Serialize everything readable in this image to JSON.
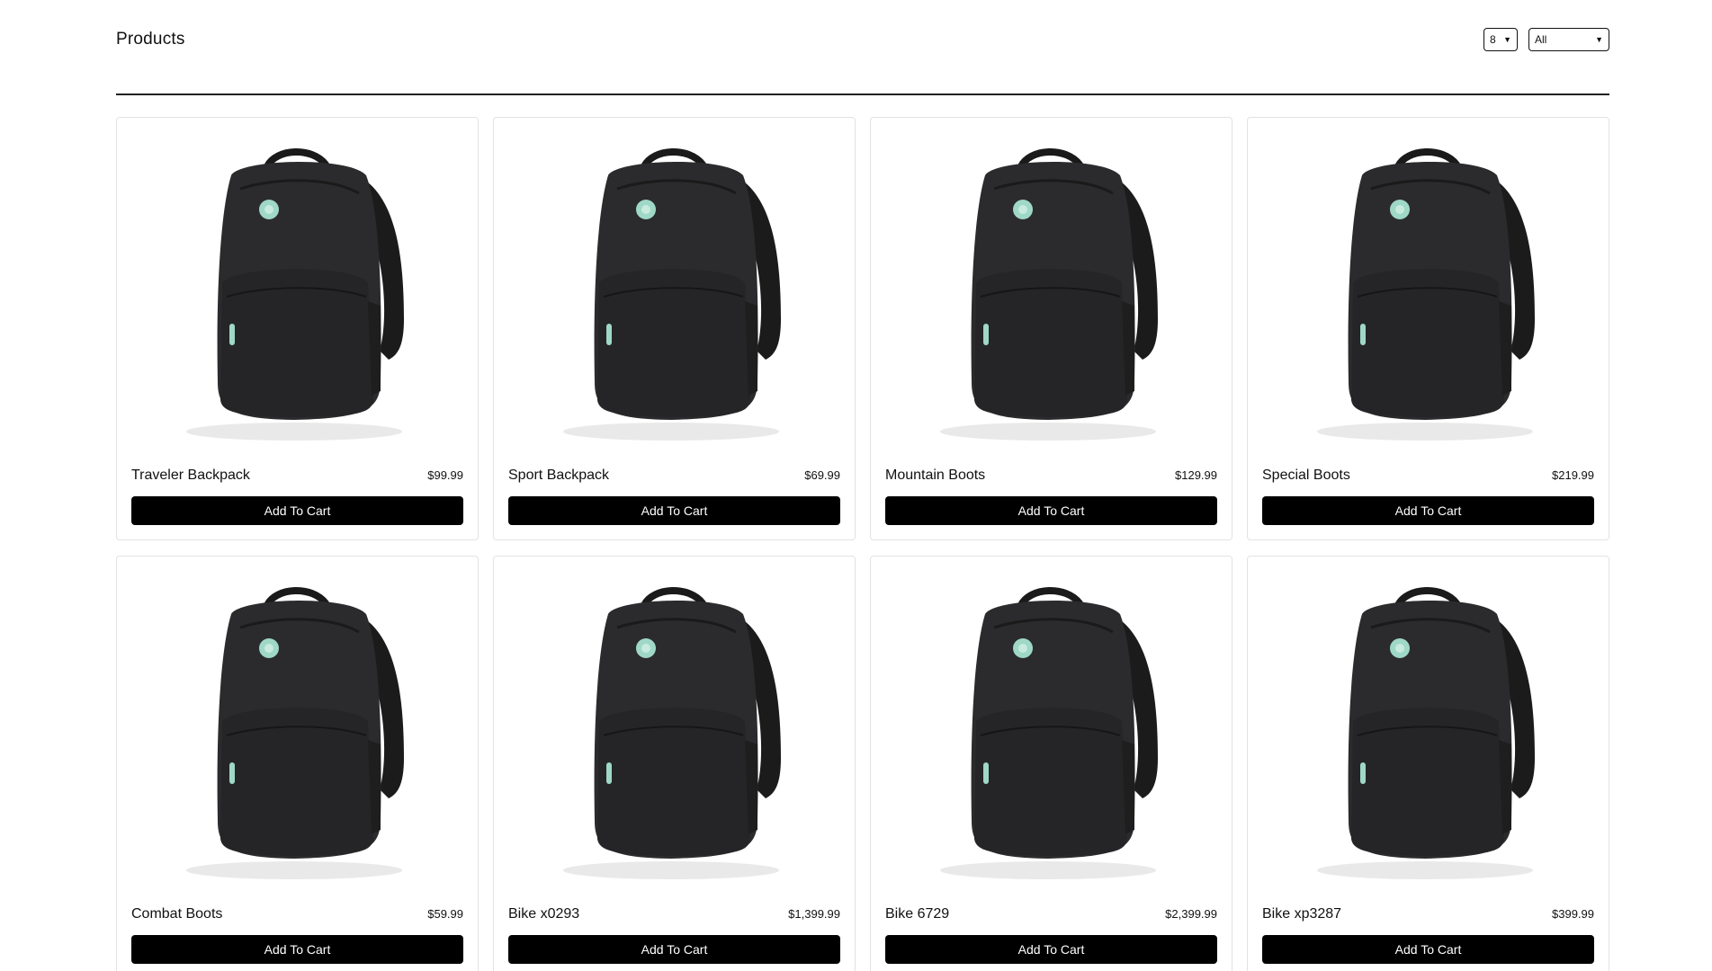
{
  "header": {
    "title": "Products",
    "per_page_select": "8",
    "category_select": "All"
  },
  "products": [
    {
      "name": "Traveler Backpack",
      "price": "$99.99",
      "button": "Add To Cart"
    },
    {
      "name": "Sport Backpack",
      "price": "$69.99",
      "button": "Add To Cart"
    },
    {
      "name": "Mountain Boots",
      "price": "$129.99",
      "button": "Add To Cart"
    },
    {
      "name": "Special Boots",
      "price": "$219.99",
      "button": "Add To Cart"
    },
    {
      "name": "Combat Boots",
      "price": "$59.99",
      "button": "Add To Cart"
    },
    {
      "name": "Bike x0293",
      "price": "$1,399.99",
      "button": "Add To Cart"
    },
    {
      "name": "Bike 6729",
      "price": "$2,399.99",
      "button": "Add To Cart"
    },
    {
      "name": "Bike xp3287",
      "price": "$399.99",
      "button": "Add To Cart"
    }
  ],
  "colors": {
    "button_bg": "#000000",
    "button_text": "#ffffff",
    "card_border": "#e3e3e3",
    "backpack_body": "#2b2b2d",
    "logo_accent": "#9fd8c6"
  },
  "icons": {
    "select_arrow": "chevron-down-icon",
    "product_image": "backpack-image"
  }
}
